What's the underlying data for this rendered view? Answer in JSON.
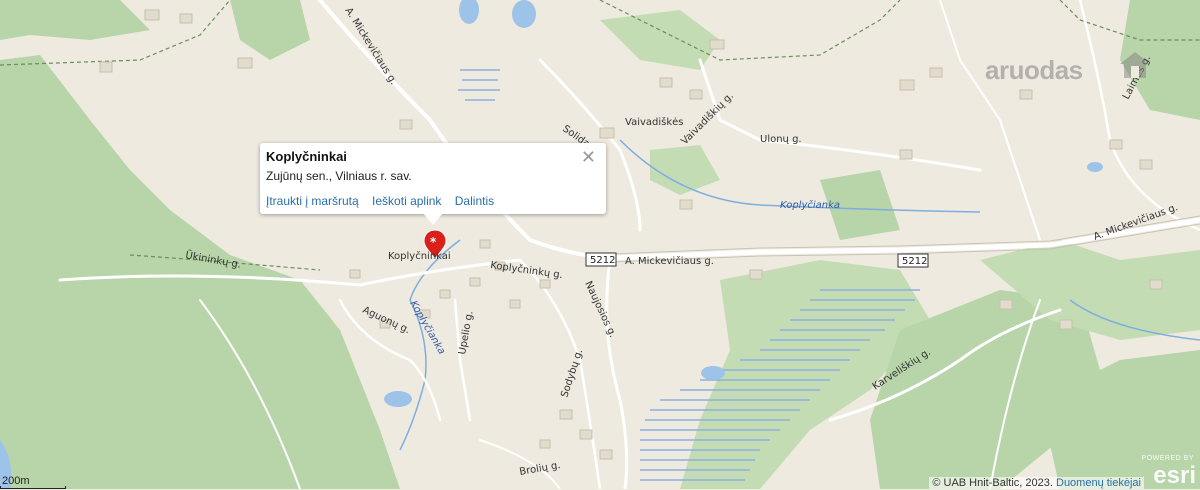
{
  "popup": {
    "title": "Koplyčninkai",
    "subtitle": "Zujūnų sen., Vilniaus r. sav.",
    "actions": [
      "Įtraukti į maršrutą",
      "Ieškoti aplink",
      "Dalintis"
    ],
    "close_icon": "close-icon"
  },
  "marker": {
    "label": "Koplyčninkai",
    "icon": "location-pin-icon",
    "color": "#d9201b"
  },
  "labels": {
    "vaivadiskes": "Vaivadiškės",
    "a_mickeviciaus_n": "A. Mickevičiaus g.",
    "a_mickeviciaus_s": "A. Mickevičiaus g.",
    "a_mickeviciaus_e": "A. Mickevičiaus g.",
    "solidaro": "Solidaro g.",
    "vaivadisku": "Vaivadiškių g.",
    "ulonu": "Ulonų g.",
    "koplycianka_1": "Koplyčianka",
    "koplycianka_2": "Koplyčianka",
    "koplycninku": "Koplyčninkų g.",
    "ukininku": "Ūkininkų g.",
    "aguonu": "Aguonų g.",
    "upelio": "Upelio g.",
    "naujosios": "Naujosios g.",
    "sodybu": "Sodybų g.",
    "laimes": "Laimės g.",
    "karveliskiu": "Karveliškių g.",
    "broliu": "Brolių g.",
    "road_5212_a": "5212",
    "road_5212_b": "5212"
  },
  "branding": {
    "logo_text": "aruodas",
    "esri_small": "POWERED BY",
    "esri_big": "esri"
  },
  "scale": {
    "label": "200m"
  },
  "attribution": {
    "text": "© UAB Hnit-Baltic, 2023. ",
    "link": "Duomenų tiekėjai"
  },
  "colors": {
    "background": "#efeae0",
    "forest": "#b4d2a8",
    "water": "#9fc4e6",
    "road": "#ffffff",
    "accent_link": "#2a6ea8"
  }
}
